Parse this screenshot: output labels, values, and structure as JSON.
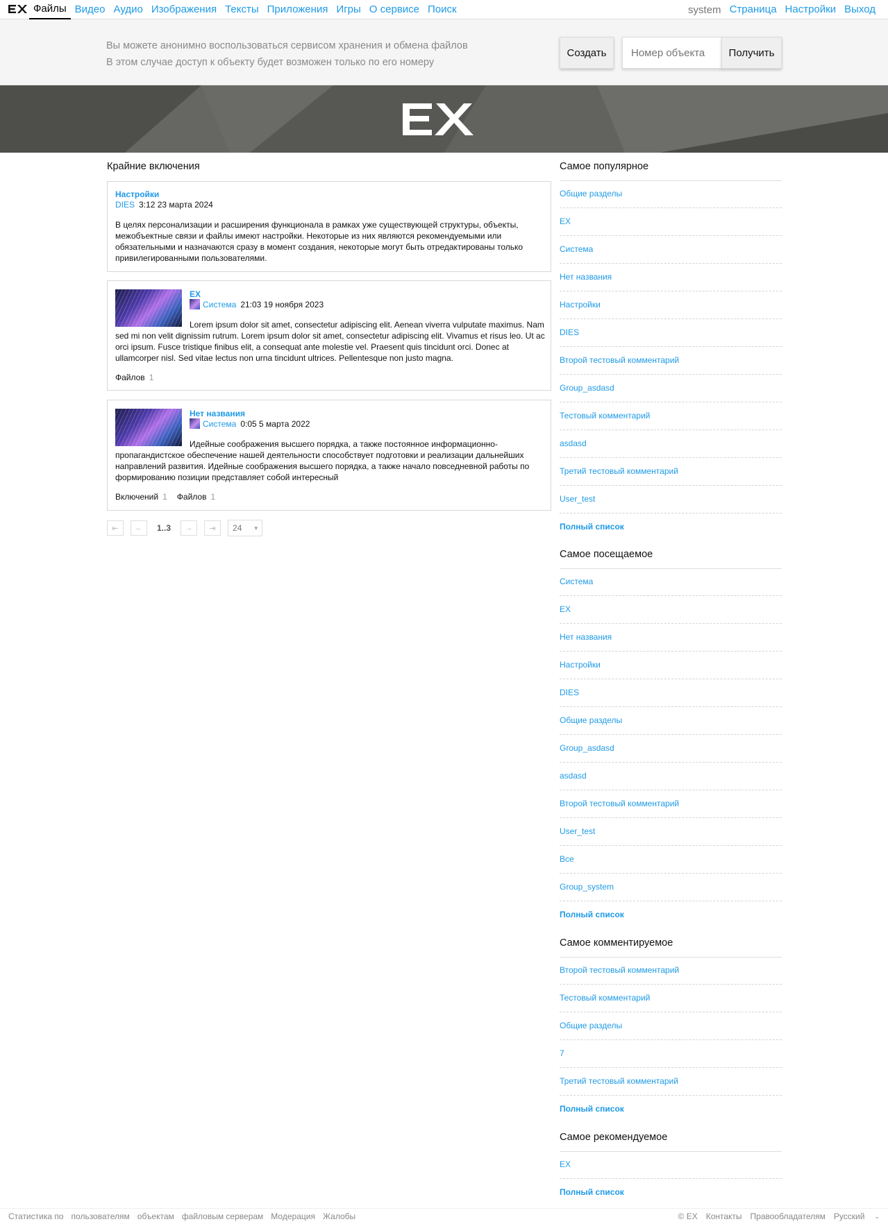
{
  "nav": {
    "logo": "EX",
    "left": [
      "Файлы",
      "Видео",
      "Аудио",
      "Изображения",
      "Тексты",
      "Приложения",
      "Игры",
      "О сервисе",
      "Поиск"
    ],
    "user": "system",
    "right": [
      "Страница",
      "Настройки",
      "Выход"
    ]
  },
  "strip": {
    "line1": "Вы можете анонимно воспользоваться сервисом хранения и обмена файлов",
    "line2": "В этом случае доступ к объекту будет возможен только по его номеру",
    "create": "Создать",
    "placeholder": "Номер объекта",
    "get": "Получить"
  },
  "banner": {
    "logo": "EX"
  },
  "main": {
    "title": "Крайние включения",
    "cards": [
      {
        "title": "Настройки",
        "author": "DIES",
        "date": "3:12 23 марта 2024",
        "text": "В целях персонализации и расширения функционала в рамках уже существующей структуры, объекты, межобъектные связи и файлы имеют настройки. Некоторые из них являются рекомендуемыми или обязательными и назначаются сразу в момент создания, некоторые могут быть отредактированы только привилегированными пользователями."
      },
      {
        "title": "EX",
        "author": "Система",
        "date": "21:03 19 ноября 2023",
        "text": "Lorem ipsum dolor sit amet, consectetur adipiscing elit. Aenean viverra vulputate maximus. Nam sed mi non velit dignissim rutrum. Lorem ipsum dolor sit amet, consectetur adipiscing elit. Vivamus et risus leo. Ut ac orci ipsum. Fusce tristique finibus elit, a consequat ante molestie vel. Praesent quis tincidunt orci. Donec at ullamcorper nisl. Sed vitae lectus non urna tincidunt ultrices. Pellentesque non justo magna.",
        "files_label": "Файлов",
        "files": "1"
      },
      {
        "title": "Нет названия",
        "author": "Система",
        "date": "0:05 5 марта 2022",
        "text": "Идейные соображения высшего порядка, а также постоянное информационно-пропагандистское обеспечение нашей деятельности способствует подготовки и реализации дальнейших направлений развития. Идейные соображения высшего порядка, а также начало повседневной работы по формированию позиции представляет собой интересный",
        "inc_label": "Включений",
        "inc": "1",
        "files_label": "Файлов",
        "files": "1"
      }
    ],
    "pager": {
      "first": "⇤",
      "prev": "←",
      "range": "1..3",
      "next": "→",
      "last": "⇥",
      "per_page": "24"
    }
  },
  "sidebar": {
    "popular": {
      "title": "Самое популярное",
      "items": [
        "Общие разделы",
        "EX",
        "Система",
        "Нет названия",
        "Настройки",
        "DIES",
        "Второй тестовый комментарий",
        "Group_asdasd",
        "Тестовый комментарий",
        "asdasd",
        "Третий тестовый комментарий",
        "User_test"
      ],
      "full": "Полный список"
    },
    "visited": {
      "title": "Самое посещаемое",
      "items": [
        "Система",
        "EX",
        "Нет названия",
        "Настройки",
        "DIES",
        "Общие разделы",
        "Group_asdasd",
        "asdasd",
        "Второй тестовый комментарий",
        "User_test",
        "Все",
        "Group_system"
      ],
      "full": "Полный список"
    },
    "commented": {
      "title": "Самое комментируемое",
      "items": [
        "Второй тестовый комментарий",
        "Тестовый комментарий",
        "Общие разделы",
        "7",
        "Третий тестовый комментарий"
      ],
      "full": "Полный список"
    },
    "recommended": {
      "title": "Самое рекомендуемое",
      "items": [
        "EX"
      ],
      "full": "Полный список"
    }
  },
  "footer": {
    "left": [
      "Статистика по",
      "пользователям",
      "объектам",
      "файловым серверам",
      "Модерация",
      "Жалобы"
    ],
    "right": [
      "© EX",
      "Контакты",
      "Правообладателям",
      "Русский"
    ]
  }
}
